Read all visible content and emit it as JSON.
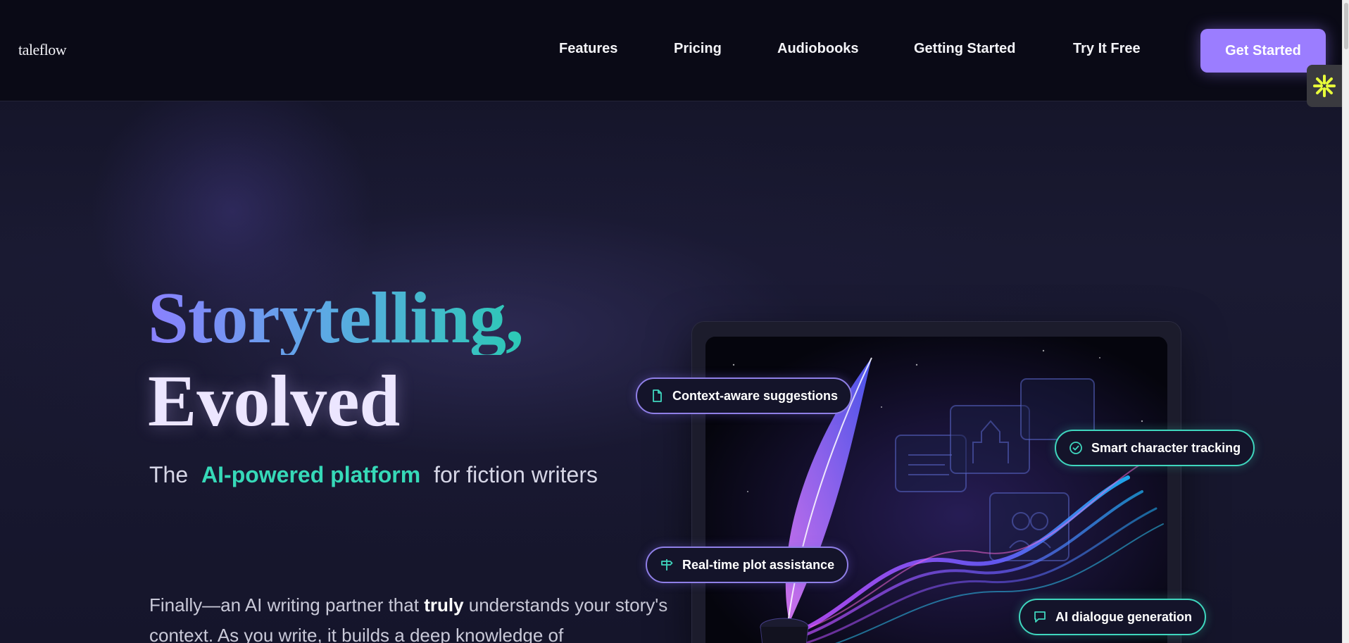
{
  "header": {
    "logo": "taleflow",
    "nav": [
      {
        "label": "Features"
      },
      {
        "label": "Pricing"
      },
      {
        "label": "Audiobooks"
      },
      {
        "label": "Getting Started"
      },
      {
        "label": "Try It Free"
      }
    ],
    "cta_label": "Get Started"
  },
  "hero": {
    "headline_line1": "Storytelling,",
    "headline_line2": "Evolved",
    "subtitle": {
      "prefix": "The",
      "accent": "AI-powered platform",
      "suffix": "for fiction writers"
    },
    "body": {
      "part1": "Finally—an AI writing partner that ",
      "bold": "truly",
      "part2": " understands your story's context. As you write, it builds a deep knowledge of"
    }
  },
  "features": [
    {
      "label": "Context-aware suggestions",
      "icon": "document-icon"
    },
    {
      "label": "Smart character tracking",
      "icon": "check-circle-icon"
    },
    {
      "label": "Real-time plot assistance",
      "icon": "signpost-icon"
    },
    {
      "label": "AI dialogue generation",
      "icon": "chat-bubble-icon"
    }
  ],
  "colors": {
    "accent_purple": "#9b7dff",
    "accent_teal": "#36d9b8",
    "background": "#0b0b17"
  }
}
